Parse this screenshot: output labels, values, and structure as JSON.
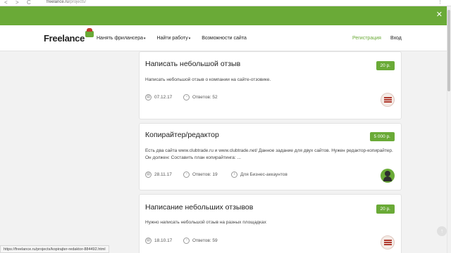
{
  "browser": {
    "url_host": "freelance.ru",
    "url_path": "/projects/",
    "back_glyph": "<",
    "forward_glyph": ">",
    "reload_glyph": "C",
    "menu_glyph": "⋮",
    "status_url": "https://freelance.ru/projects/kopirajter-redaktor-884492.html"
  },
  "banner": {
    "close_glyph": "✕"
  },
  "header": {
    "logo_text": "Freelance",
    "nav": [
      {
        "label": "Нанять фрилансера",
        "has_caret": true
      },
      {
        "label": "Найти работу",
        "has_caret": true
      },
      {
        "label": "Возможности сайта",
        "has_caret": false
      }
    ],
    "register_label": "Регистрация",
    "login_label": "Вход",
    "caret_glyph": "▾"
  },
  "projects": [
    {
      "title": "Написать небольшой отзыв",
      "price": "20 р.",
      "description": "Написать небольшой отзыв о компании на сайте-отзовике.",
      "date": "07.12.17",
      "replies": "Ответов: 52",
      "avatar_icon": "striped-avatar-icon"
    },
    {
      "title": "Копирайтер/редактор",
      "price": "5 000 р.",
      "description": "Есть два сайта www.clubtrade.ru и www.clubtrade.net/ Данное задание для двух сайтов. Нужен редактор-копирайтер. Он должен: Составить план копирайтинга: ...",
      "date": "28.11.17",
      "replies": "Ответов: 19",
      "business_label": "Для Бизнес-аккаунтов",
      "avatar_icon": "person-avatar-icon"
    },
    {
      "title": "Написание небольших отзывов",
      "price": "20 р.",
      "description": "Нужно написать небольшой отзыв на разных площадках",
      "date": "18.10.17",
      "replies": "Ответов: 59",
      "avatar_icon": "striped-avatar-icon"
    }
  ],
  "icons": {
    "calendar": "▤",
    "replies": "◔",
    "info": "i",
    "scroll_up": "↑"
  },
  "colors": {
    "brand_green": "#6aaa37",
    "text_dark": "#222222",
    "avatar_red": "#b0392e"
  }
}
